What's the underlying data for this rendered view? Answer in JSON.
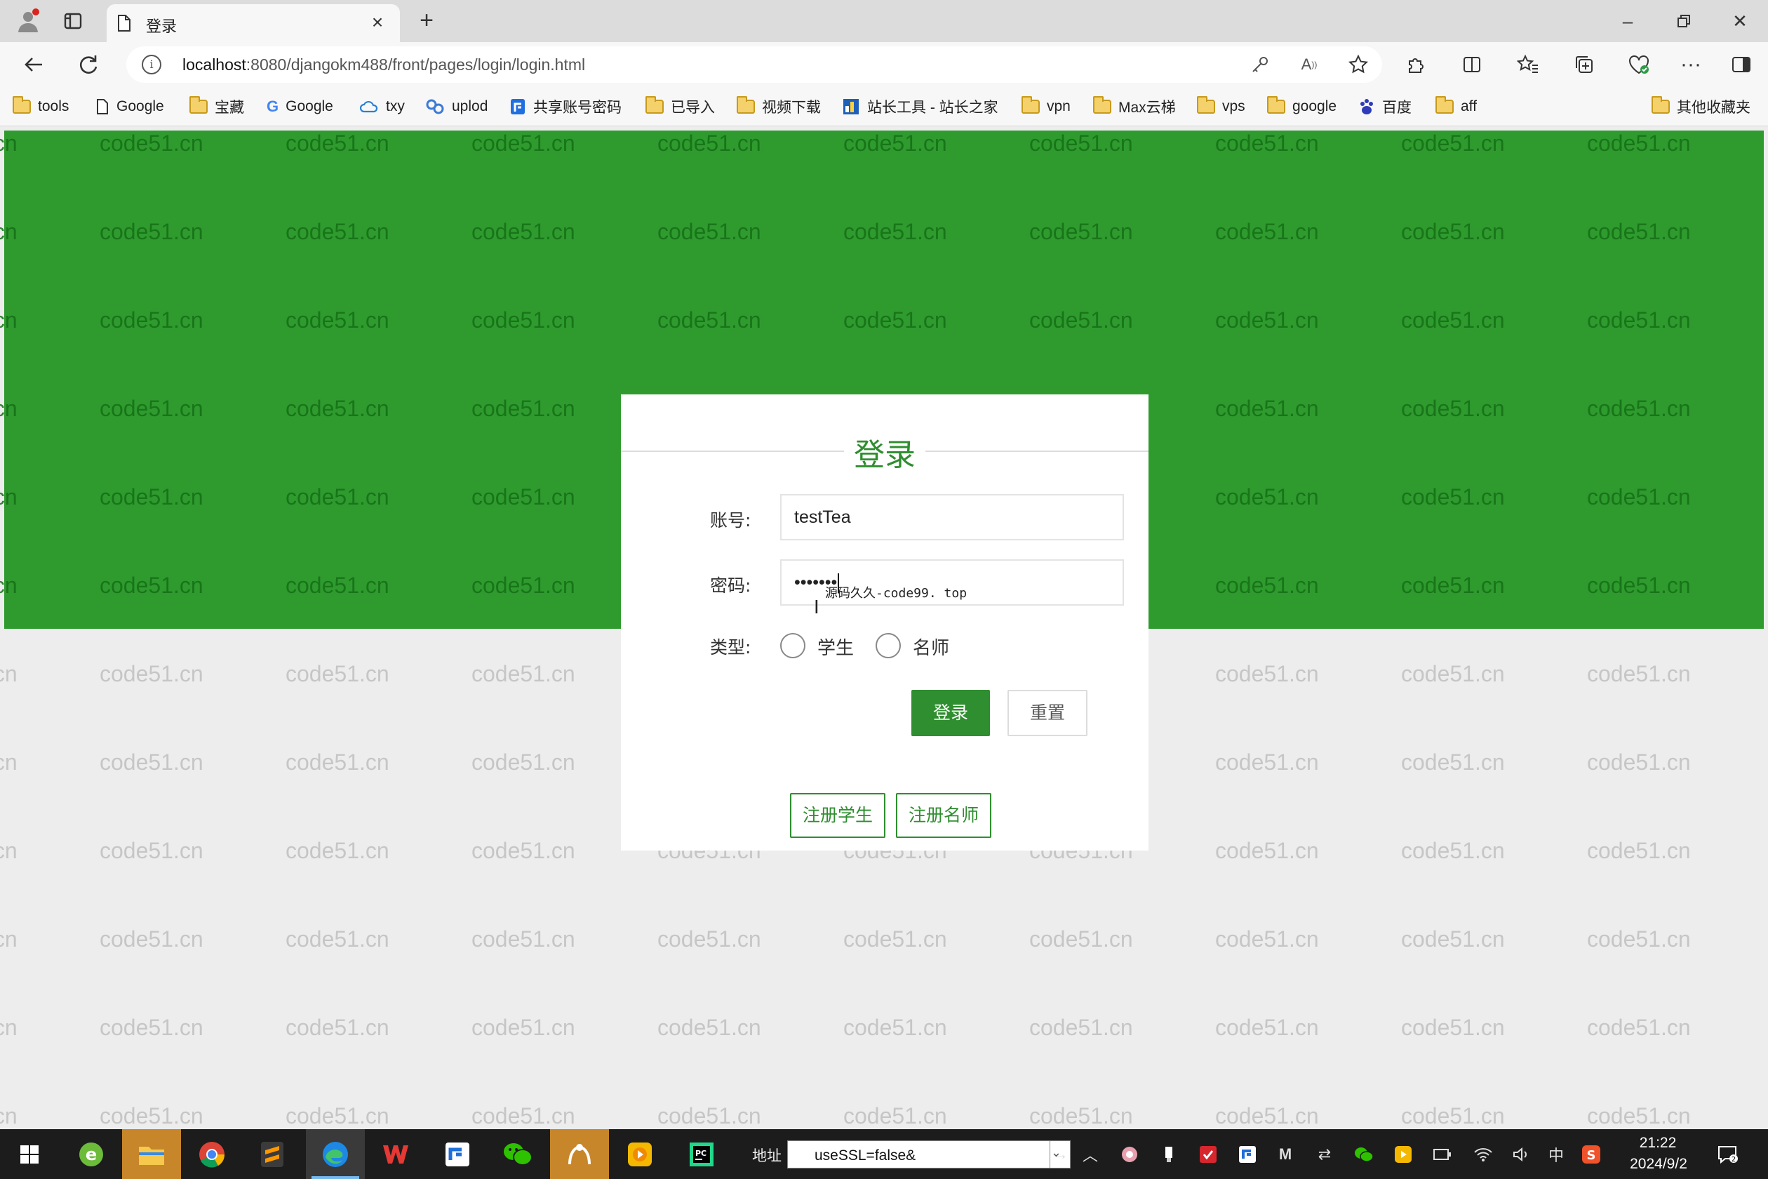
{
  "browser": {
    "tab_title": "登录",
    "url_host": "localhost",
    "url_rest": ":8080/djangokm488/front/pages/login/login.html"
  },
  "bookmarks": [
    {
      "label": "tools",
      "icon": "folder-icon"
    },
    {
      "label": "Google",
      "icon": "page-icon"
    },
    {
      "label": "宝藏",
      "icon": "folder-icon"
    },
    {
      "label": "Google",
      "icon": "google-icon"
    },
    {
      "label": "txy",
      "icon": "cloud-icon"
    },
    {
      "label": "uplod",
      "icon": "link-icon"
    },
    {
      "label": "共享账号密码",
      "icon": "share-icon"
    },
    {
      "label": "已导入",
      "icon": "folder-icon"
    },
    {
      "label": "视频下载",
      "icon": "folder-icon"
    },
    {
      "label": "站长工具 - 站长之家",
      "icon": "site-icon"
    },
    {
      "label": "vpn",
      "icon": "folder-icon"
    },
    {
      "label": "Max云梯",
      "icon": "folder-icon"
    },
    {
      "label": "vps",
      "icon": "folder-icon"
    },
    {
      "label": "google",
      "icon": "folder-icon"
    },
    {
      "label": "百度",
      "icon": "baidu-icon"
    },
    {
      "label": "aff",
      "icon": "folder-icon"
    },
    {
      "label": "其他收藏夹",
      "icon": "folder-icon"
    }
  ],
  "watermark": "code51.cn",
  "login": {
    "title": "登录",
    "account_label": "账号:",
    "account_value": "testTea",
    "password_label": "密码:",
    "password_value": "•••••••",
    "tooltip": "源码久久-code99. top",
    "type_label": "类型:",
    "options": [
      "学生",
      "名师"
    ],
    "login_button": "登录",
    "reset_button": "重置",
    "register_student": "注册学生",
    "register_teacher": "注册名师"
  },
  "taskbar": {
    "address_label": "地址",
    "address_value": "useSSL=false&",
    "ime": "中",
    "time": "21:22",
    "date": "2024/9/2"
  },
  "colors": {
    "brand_green": "#2f9b2f",
    "button_green": "#2f8e2f"
  }
}
